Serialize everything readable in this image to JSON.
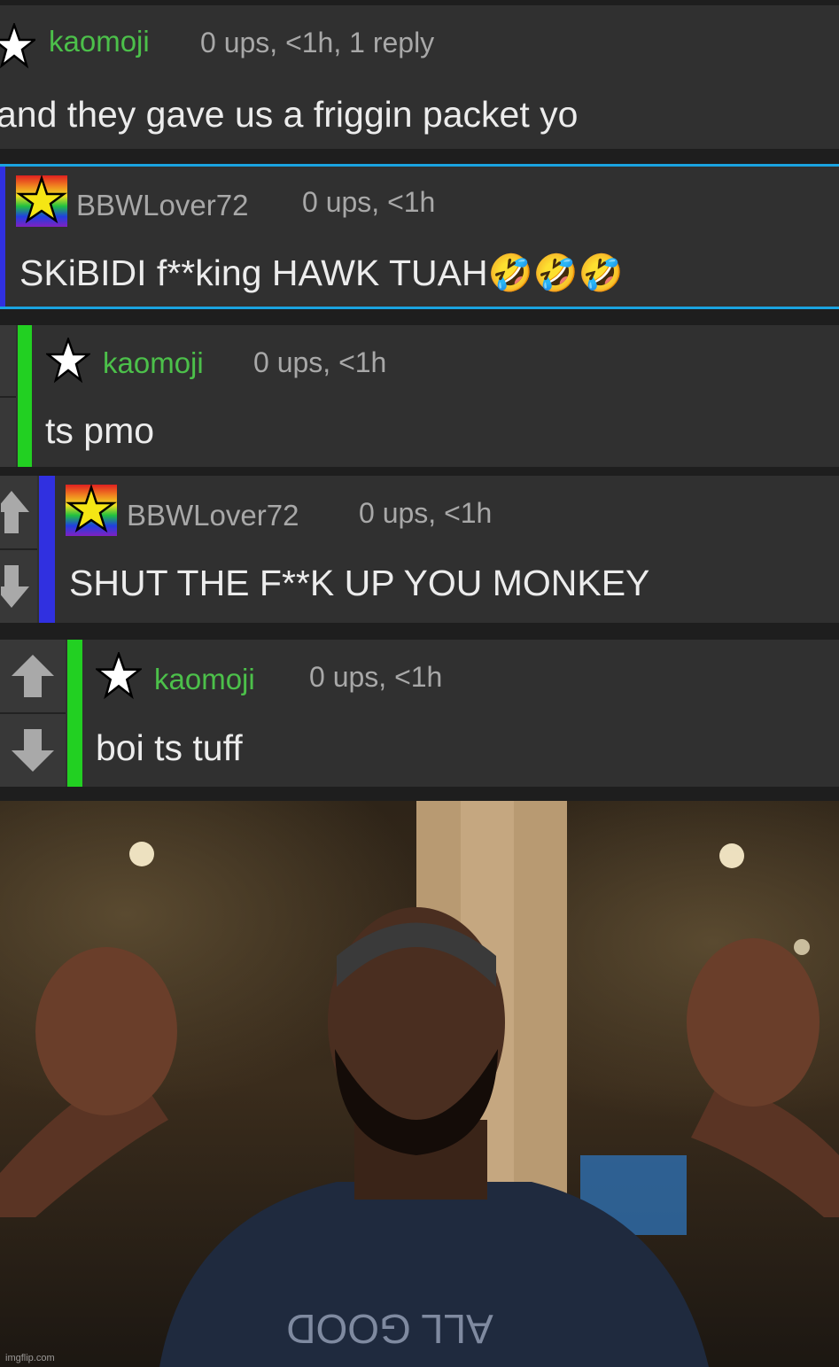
{
  "colors": {
    "background": "#303030",
    "username_green": "#4cc04a",
    "meta_gray": "#a8a8a8",
    "text": "#ececec",
    "highlight_border": "#1aa3e0",
    "bar_blue": "#3030e0",
    "bar_green": "#22d022"
  },
  "comments": [
    {
      "username": "kaomoji",
      "meta": "0 ups, <1h, 1 reply",
      "text": "and they gave us a friggin packet yo",
      "badge": "star-icon"
    },
    {
      "username": "BBWLover72",
      "meta": "0 ups, <1h",
      "text": "SKiBIDI f**king HAWK TUAH🤣🤣🤣",
      "badge": "rainbow-star-badge-icon"
    },
    {
      "username": "kaomoji",
      "meta": "0 ups, <1h",
      "text": "ts pmo",
      "badge": "star-icon"
    },
    {
      "username": "BBWLover72",
      "meta": "0 ups, <1h",
      "text": "SHUT THE F**K UP YOU MONKEY",
      "badge": "rainbow-star-badge-icon"
    },
    {
      "username": "kaomoji",
      "meta": "0 ups, <1h",
      "text": "boi ts tuff",
      "badge": "star-icon"
    }
  ],
  "photo": {
    "shirt_text": "ALL GOOD",
    "watermark": "imgflip.com"
  }
}
